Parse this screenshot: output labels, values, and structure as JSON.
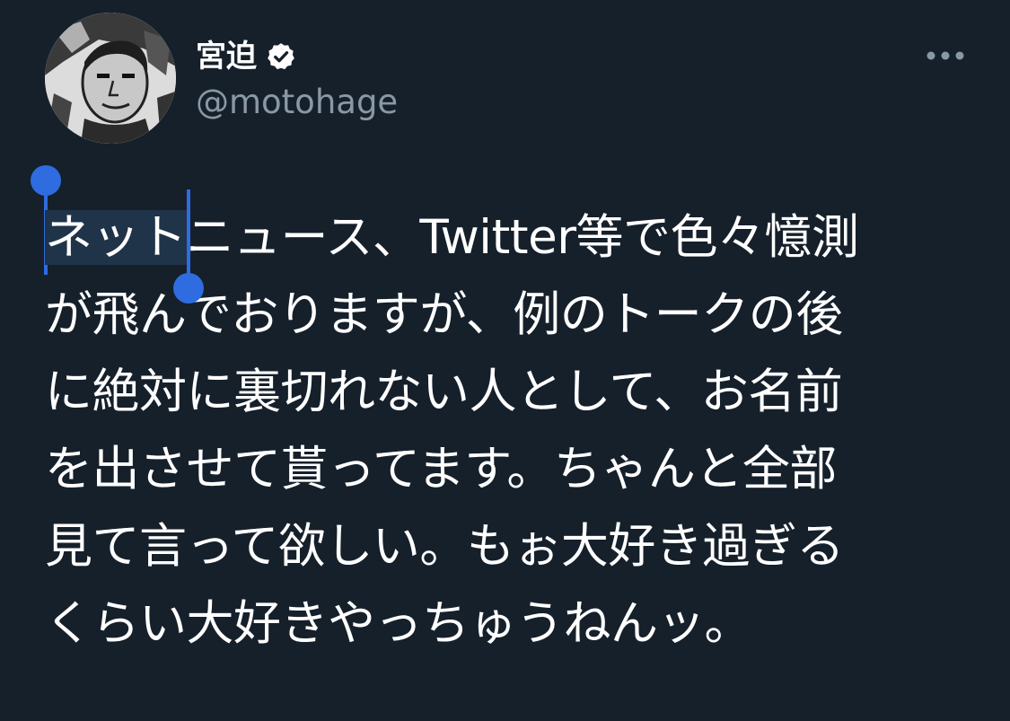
{
  "tweet": {
    "author": {
      "display_name": "宮迫",
      "handle": "@motohage",
      "verified": true,
      "avatar_icon": "profile-avatar"
    },
    "more_icon": "more-dots-icon",
    "selected_text": "ネット",
    "lines": [
      "ニュース、Twitter等で色々憶測",
      "が飛んでおりますが、例のトークの後",
      "に絶対に裏切れない人として、お名前",
      "を出させて貰ってます。ちゃんと全部",
      "見て言って欲しい。もぉ大好き過ぎる",
      "くらい大好きやっちゅうねんッ。"
    ]
  },
  "colors": {
    "background": "#16202b",
    "text": "#ffffff",
    "secondary_text": "#8899a6",
    "selection_handle": "#2f6ce0",
    "selection_fill": "#1f3349"
  }
}
